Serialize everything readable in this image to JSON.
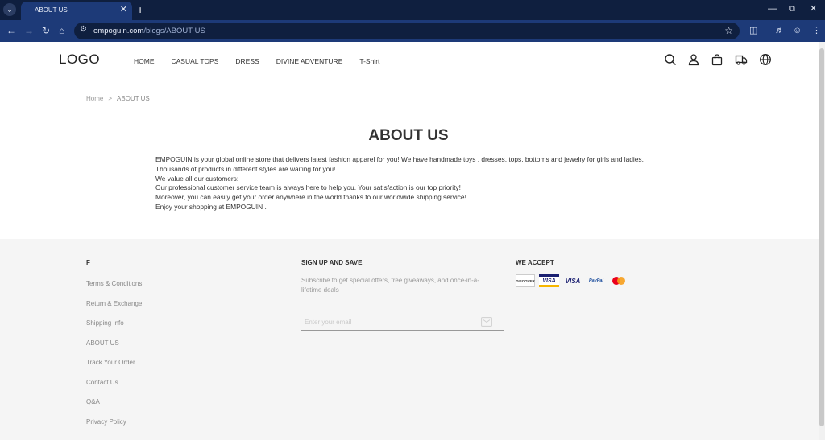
{
  "browser": {
    "tab_title": "ABOUT US",
    "new_tab": "+",
    "url_domain": "empoguin.com",
    "url_path": "/blogs/ABOUT-US"
  },
  "header": {
    "logo": "LOGO",
    "menu": [
      "HOME",
      "CASUAL TOPS",
      "DRESS",
      "DIVINE ADVENTURE",
      "T-Shirt"
    ]
  },
  "breadcrumb": {
    "home": "Home",
    "separator": ">",
    "current": "ABOUT US"
  },
  "main": {
    "title": "ABOUT US",
    "paragraphs": [
      "EMPOGUIN is your global online store that delivers latest fashion apparel for you! We have handmade toys , dresses, tops, bottoms and jewelry for girls and ladies.",
      "Thousands of products in different styles are waiting for you!",
      "We value all our customers:",
      "Our professional customer service team is always here to help you. Your satisfaction is our top priority!",
      "Moreover, you can easily get your order anywhere in the world thanks to our worldwide shipping service!",
      "Enjoy your shopping at  EMPOGUIN ."
    ]
  },
  "footer": {
    "col1_title": "F",
    "links": [
      "Terms & Conditions",
      "Return & Exchange",
      "Shipping Info",
      "ABOUT US",
      "Track Your Order",
      "Contact Us",
      "Q&A",
      "Privacy Policy"
    ],
    "signup_title": "SIGN UP AND SAVE",
    "signup_desc": "Subscribe to get special offers, free giveaways, and once-in-a-lifetime deals",
    "email_placeholder": "Enter your email",
    "accept_title": "WE ACCEPT",
    "cards": [
      "DISCOVER",
      "VISA",
      "VISA",
      "PayPal",
      "mastercard"
    ]
  },
  "colors": {
    "chrome_dark": "#0f1f3f",
    "chrome_blue": "#1d3a78",
    "footer_bg": "#f5f5f5",
    "text": "#333333"
  }
}
